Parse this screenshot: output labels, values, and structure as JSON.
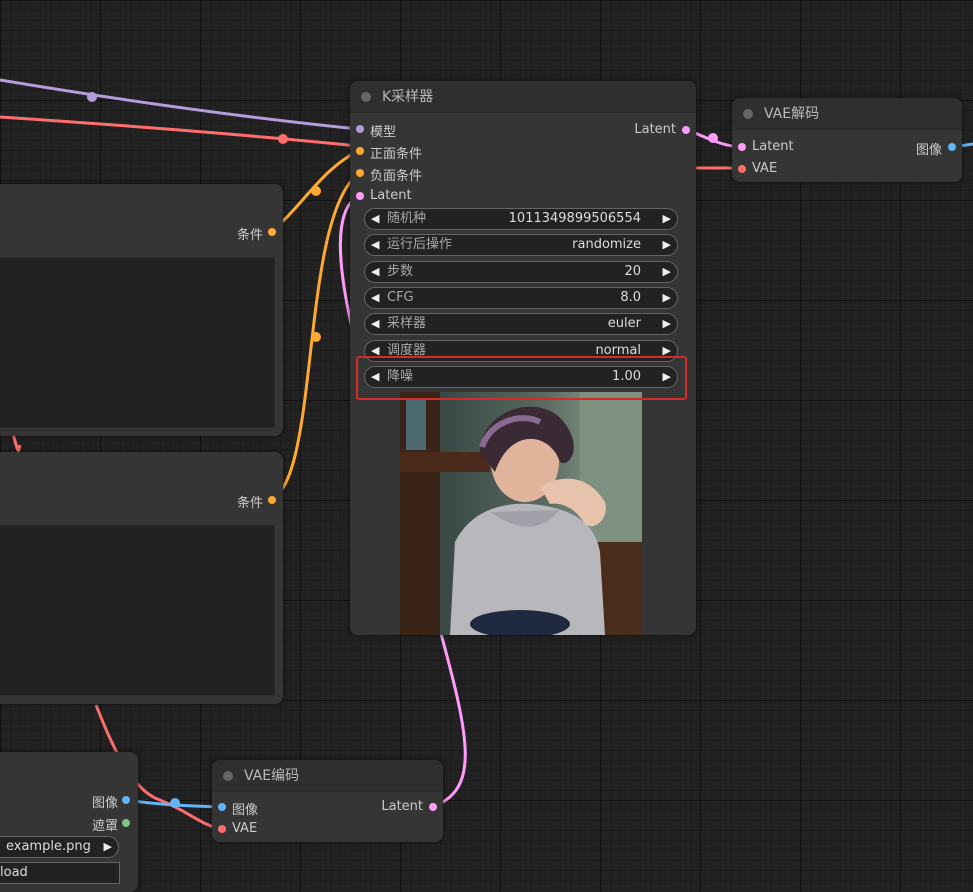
{
  "ksampler": {
    "title": "K采样器",
    "inputs": {
      "model": "模型",
      "positive": "正面条件",
      "negative": "负面条件",
      "latent": "Latent"
    },
    "output": "Latent",
    "widgets": [
      {
        "label": "随机种",
        "value": "1011349899506554"
      },
      {
        "label": "运行后操作",
        "value": "randomize"
      },
      {
        "label": "步数",
        "value": "20"
      },
      {
        "label": "CFG",
        "value": "8.0"
      },
      {
        "label": "采样器",
        "value": "euler"
      },
      {
        "label": "调度器",
        "value": "normal"
      },
      {
        "label": "降噪",
        "value": "1.00"
      }
    ]
  },
  "vae_decode": {
    "title": "VAE解码",
    "inputs": {
      "latent": "Latent",
      "vae": "VAE"
    },
    "output": "图像"
  },
  "vae_encode": {
    "title": "VAE编码",
    "inputs": {
      "image": "图像",
      "vae": "VAE"
    },
    "output": "Latent"
  },
  "clip_positive": {
    "output": "条件"
  },
  "clip_negative": {
    "output": "条件"
  },
  "load_image": {
    "outputs": {
      "image": "图像",
      "mask": "遮罩"
    },
    "image_value": "example.png",
    "upload_label": "load"
  },
  "colors": {
    "model": "#b39ddb",
    "conditioning": "#ffa931",
    "latent": "#ff9cf9",
    "vae": "#ff6e6e",
    "image": "#64b5f6",
    "mask": "#81c784",
    "highlight": "#d42a2a"
  }
}
